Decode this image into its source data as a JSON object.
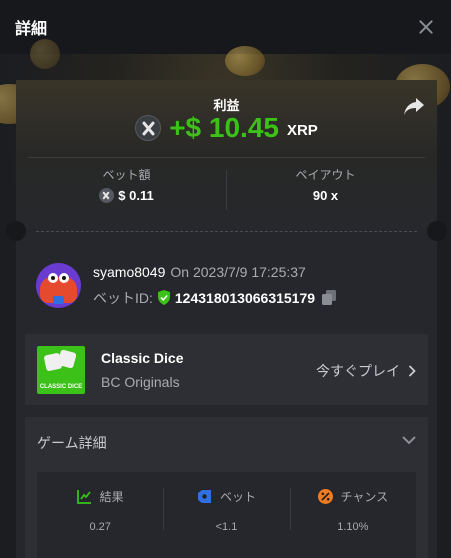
{
  "header": {
    "title": "詳細"
  },
  "profit": {
    "label": "利益",
    "amount": "+$ 10.45",
    "currency": "XRP"
  },
  "bet_amount": {
    "label": "ベット額",
    "value": "$ 0.11"
  },
  "payout": {
    "label": "ペイアウト",
    "value": "90 x"
  },
  "user": {
    "name": "syamo8049",
    "date": "On 2023/7/9 17:25:37",
    "bet_id_label": "ベットID:",
    "bet_id": "124318013066315179"
  },
  "game": {
    "name": "Classic Dice",
    "provider": "BC Originals",
    "play_label": "今すぐプレイ",
    "thumb_text": "CLASSIC DICE"
  },
  "details": {
    "title": "ゲーム詳細",
    "columns": [
      {
        "label": "結果",
        "value": "0.27",
        "icon": "result-chart-icon",
        "color": "#3bc117"
      },
      {
        "label": "ベット",
        "value": "<1.1",
        "icon": "bet-tag-icon",
        "color": "#2f6fe0"
      },
      {
        "label": "チャンス",
        "value": "1.10%",
        "icon": "percent-icon",
        "color": "#f37b21"
      }
    ]
  },
  "colors": {
    "accent_green": "#3bc117",
    "background": "#17181b",
    "card": "#25272c"
  }
}
